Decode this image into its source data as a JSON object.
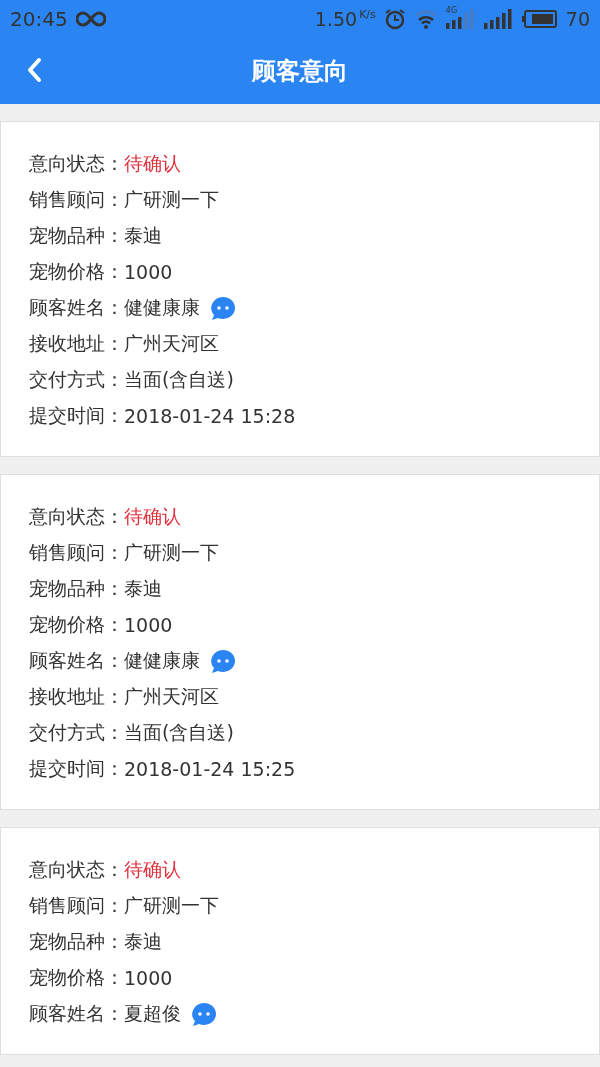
{
  "status_bar": {
    "time": "20:45",
    "speed": "1.50",
    "speed_unit": "K/s",
    "network": "4G",
    "battery": "70"
  },
  "app_bar": {
    "title": "顾客意向"
  },
  "cards": [
    {
      "fields": [
        {
          "label": "意向状态：",
          "value": "待确认",
          "kind": "status"
        },
        {
          "label": "销售顾问：",
          "value": "广研测一下",
          "kind": "text"
        },
        {
          "label": "宠物品种：",
          "value": "泰迪",
          "kind": "text"
        },
        {
          "label": "宠物价格：",
          "value": "1000",
          "kind": "text"
        },
        {
          "label": "顾客姓名：",
          "value": "健健康康",
          "kind": "chat"
        },
        {
          "label": "接收地址：",
          "value": "广州天河区",
          "kind": "text"
        },
        {
          "label": "交付方式：",
          "value": "当面(含自送)",
          "kind": "text"
        },
        {
          "label": "提交时间：",
          "value": "2018-01-24 15:28",
          "kind": "text"
        }
      ]
    },
    {
      "fields": [
        {
          "label": "意向状态：",
          "value": "待确认",
          "kind": "status"
        },
        {
          "label": "销售顾问：",
          "value": "广研测一下",
          "kind": "text"
        },
        {
          "label": "宠物品种：",
          "value": "泰迪",
          "kind": "text"
        },
        {
          "label": "宠物价格：",
          "value": "1000",
          "kind": "text"
        },
        {
          "label": "顾客姓名：",
          "value": "健健康康",
          "kind": "chat"
        },
        {
          "label": "接收地址：",
          "value": "广州天河区",
          "kind": "text"
        },
        {
          "label": "交付方式：",
          "value": "当面(含自送)",
          "kind": "text"
        },
        {
          "label": "提交时间：",
          "value": "2018-01-24 15:25",
          "kind": "text"
        }
      ]
    },
    {
      "fields": [
        {
          "label": "意向状态：",
          "value": "待确认",
          "kind": "status"
        },
        {
          "label": "销售顾问：",
          "value": "广研测一下",
          "kind": "text"
        },
        {
          "label": "宠物品种：",
          "value": "泰迪",
          "kind": "text"
        },
        {
          "label": "宠物价格：",
          "value": "1000",
          "kind": "text"
        },
        {
          "label": "顾客姓名：",
          "value": "夏超俊",
          "kind": "chat"
        }
      ]
    }
  ]
}
